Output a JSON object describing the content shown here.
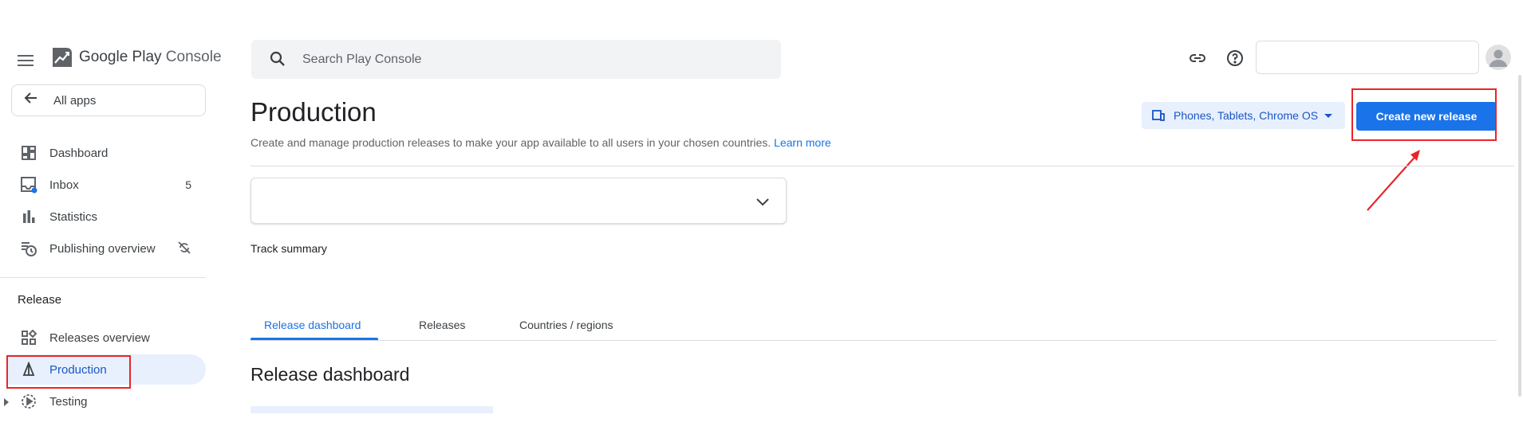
{
  "app": {
    "name_primary": "Google Play",
    "name_secondary": "Console"
  },
  "search": {
    "placeholder": "Search Play Console"
  },
  "sidebar": {
    "all_apps": "All apps",
    "items": [
      {
        "label": "Dashboard",
        "icon": "dashboard-icon"
      },
      {
        "label": "Inbox",
        "icon": "inbox-icon",
        "badge": "5"
      },
      {
        "label": "Statistics",
        "icon": "bar-chart-icon"
      },
      {
        "label": "Publishing overview",
        "icon": "publishing-icon"
      }
    ],
    "section": "Release",
    "release_items": [
      {
        "label": "Releases overview",
        "icon": "releases-overview-icon"
      },
      {
        "label": "Production",
        "icon": "production-icon",
        "active": true
      },
      {
        "label": "Testing",
        "icon": "testing-icon"
      }
    ]
  },
  "main": {
    "title": "Production",
    "subtitle": "Create and manage production releases to make your app available to all users in your chosen countries.",
    "learn_more": "Learn more",
    "device_filter": "Phones, Tablets, Chrome OS",
    "create_button": "Create new release",
    "track_summary": "Track summary",
    "tabs": [
      "Release dashboard",
      "Releases",
      "Countries / regions"
    ],
    "section_title": "Release dashboard"
  },
  "colors": {
    "accent": "#1a73e8",
    "highlight_box": "#e8262a",
    "active_bg": "#e8f0fe"
  }
}
